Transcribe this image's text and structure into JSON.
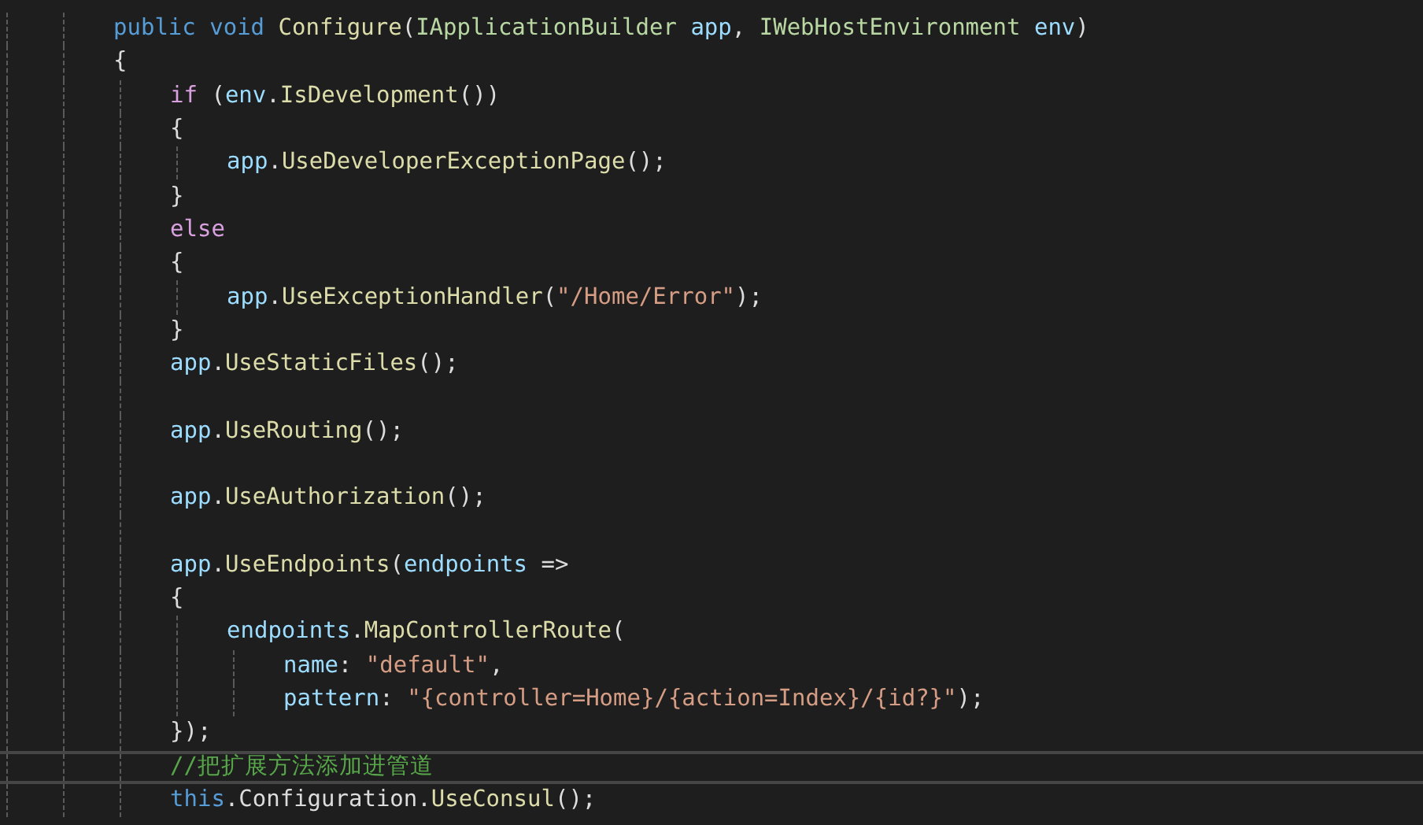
{
  "code": [
    {
      "current": false,
      "tokens": [
        {
          "kind": "kw",
          "text": "public "
        },
        {
          "kind": "kw",
          "text": "void "
        },
        {
          "kind": "method",
          "text": "Configure"
        },
        {
          "kind": "punct",
          "text": "("
        },
        {
          "kind": "type",
          "text": "IApplicationBuilder "
        },
        {
          "kind": "var",
          "text": "app"
        },
        {
          "kind": "punct",
          "text": ", "
        },
        {
          "kind": "type",
          "text": "IWebHostEnvironment "
        },
        {
          "kind": "var",
          "text": "env"
        },
        {
          "kind": "punct",
          "text": ")"
        }
      ]
    },
    {
      "current": false,
      "tokens": [
        {
          "kind": "punct",
          "text": "{"
        }
      ],
      "children": [
        {
          "current": false,
          "tokens": [
            {
              "kind": "ctrl",
              "text": "if "
            },
            {
              "kind": "punct",
              "text": "("
            },
            {
              "kind": "var",
              "text": "env"
            },
            {
              "kind": "punct",
              "text": "."
            },
            {
              "kind": "method",
              "text": "IsDevelopment"
            },
            {
              "kind": "punct",
              "text": "())"
            }
          ]
        },
        {
          "current": false,
          "tokens": [
            {
              "kind": "punct",
              "text": "{"
            }
          ],
          "children": [
            {
              "current": false,
              "tokens": [
                {
                  "kind": "var",
                  "text": "app"
                },
                {
                  "kind": "punct",
                  "text": "."
                },
                {
                  "kind": "method",
                  "text": "UseDeveloperExceptionPage"
                },
                {
                  "kind": "punct",
                  "text": "();"
                }
              ]
            }
          ]
        },
        {
          "current": false,
          "tokens": [
            {
              "kind": "punct",
              "text": "}"
            }
          ]
        },
        {
          "current": false,
          "tokens": [
            {
              "kind": "ctrl",
              "text": "else"
            }
          ]
        },
        {
          "current": false,
          "tokens": [
            {
              "kind": "punct",
              "text": "{"
            }
          ],
          "children": [
            {
              "current": false,
              "tokens": [
                {
                  "kind": "var",
                  "text": "app"
                },
                {
                  "kind": "punct",
                  "text": "."
                },
                {
                  "kind": "method",
                  "text": "UseExceptionHandler"
                },
                {
                  "kind": "punct",
                  "text": "("
                },
                {
                  "kind": "str",
                  "text": "\"/Home/Error\""
                },
                {
                  "kind": "punct",
                  "text": ");"
                }
              ]
            }
          ]
        },
        {
          "current": false,
          "tokens": [
            {
              "kind": "punct",
              "text": "}"
            }
          ]
        },
        {
          "current": false,
          "tokens": [
            {
              "kind": "var",
              "text": "app"
            },
            {
              "kind": "punct",
              "text": "."
            },
            {
              "kind": "method",
              "text": "UseStaticFiles"
            },
            {
              "kind": "punct",
              "text": "();"
            }
          ]
        },
        {
          "current": false
        },
        {
          "current": false,
          "tokens": [
            {
              "kind": "var",
              "text": "app"
            },
            {
              "kind": "punct",
              "text": "."
            },
            {
              "kind": "method",
              "text": "UseRouting"
            },
            {
              "kind": "punct",
              "text": "();"
            }
          ]
        },
        {
          "current": false
        },
        {
          "current": false,
          "tokens": [
            {
              "kind": "var",
              "text": "app"
            },
            {
              "kind": "punct",
              "text": "."
            },
            {
              "kind": "method",
              "text": "UseAuthorization"
            },
            {
              "kind": "punct",
              "text": "();"
            }
          ]
        },
        {
          "current": false
        },
        {
          "current": false,
          "tokens": [
            {
              "kind": "var",
              "text": "app"
            },
            {
              "kind": "punct",
              "text": "."
            },
            {
              "kind": "method",
              "text": "UseEndpoints"
            },
            {
              "kind": "punct",
              "text": "("
            },
            {
              "kind": "var",
              "text": "endpoints"
            },
            {
              "kind": "punct",
              "text": " =>"
            }
          ]
        },
        {
          "current": false,
          "tokens": [
            {
              "kind": "punct",
              "text": "{"
            }
          ],
          "children": [
            {
              "current": false,
              "tokens": [
                {
                  "kind": "var",
                  "text": "endpoints"
                },
                {
                  "kind": "punct",
                  "text": "."
                },
                {
                  "kind": "method",
                  "text": "MapControllerRoute"
                },
                {
                  "kind": "punct",
                  "text": "("
                }
              ],
              "children": [
                {
                  "current": false,
                  "tokens": [
                    {
                      "kind": "var",
                      "text": "name"
                    },
                    {
                      "kind": "punct",
                      "text": ": "
                    },
                    {
                      "kind": "str",
                      "text": "\"default\""
                    },
                    {
                      "kind": "punct",
                      "text": ","
                    }
                  ]
                },
                {
                  "current": false,
                  "tokens": [
                    {
                      "kind": "var",
                      "text": "pattern"
                    },
                    {
                      "kind": "punct",
                      "text": ": "
                    },
                    {
                      "kind": "str",
                      "text": "\"{controller=Home}/{action=Index}/{id?}\""
                    },
                    {
                      "kind": "punct",
                      "text": ");"
                    }
                  ]
                }
              ]
            }
          ]
        },
        {
          "current": false,
          "tokens": [
            {
              "kind": "punct",
              "text": "});"
            }
          ]
        },
        {
          "current": true,
          "tokens": [
            {
              "kind": "comment",
              "text": "//把扩展方法添加进管道"
            }
          ]
        },
        {
          "current": false,
          "tokens": [
            {
              "kind": "kw",
              "text": "this"
            },
            {
              "kind": "punct",
              "text": "."
            },
            {
              "kind": "plain",
              "text": "Configuration"
            },
            {
              "kind": "punct",
              "text": "."
            },
            {
              "kind": "method",
              "text": "UseConsul"
            },
            {
              "kind": "punct",
              "text": "();"
            }
          ]
        }
      ]
    }
  ]
}
